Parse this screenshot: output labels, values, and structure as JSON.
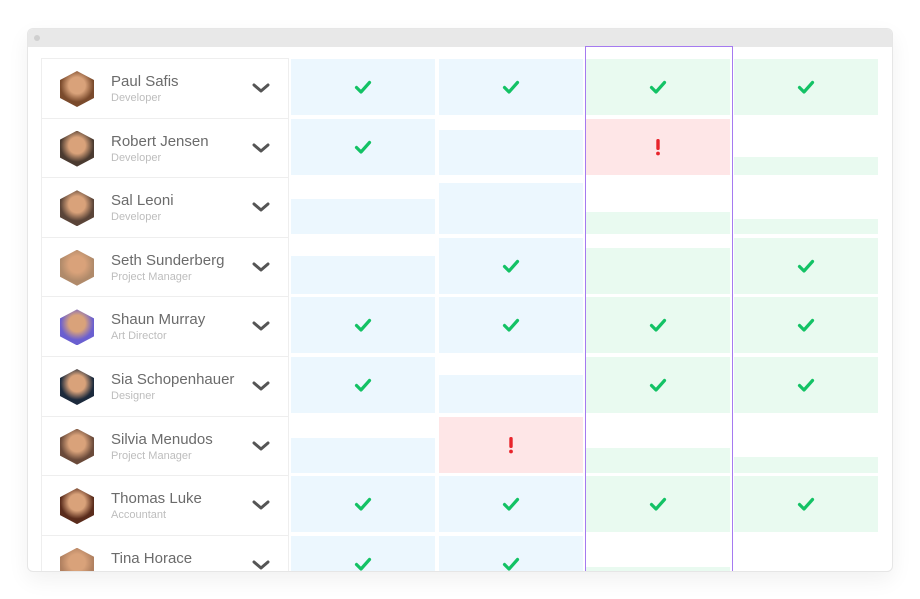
{
  "colors": {
    "check": "#13c265",
    "alert": "#e8242b",
    "blue_fill": "#ecf7fe",
    "green_fill": "#e9faf0",
    "red_fill": "#fee6e7",
    "highlight_border": "#a57af0"
  },
  "columns": [
    {
      "tone": "blue"
    },
    {
      "tone": "blue"
    },
    {
      "tone": "green",
      "highlighted": true
    },
    {
      "tone": "green"
    }
  ],
  "people": [
    {
      "name": "Paul Safis",
      "role": "Developer",
      "avatar_color": "#7a4a2c",
      "cells": [
        {
          "fill": 1.0,
          "status": "check"
        },
        {
          "fill": 1.0,
          "status": "check"
        },
        {
          "fill": 1.0,
          "status": "check"
        },
        {
          "fill": 1.0,
          "status": "check"
        }
      ]
    },
    {
      "name": "Robert Jensen",
      "role": "Developer",
      "avatar_color": "#4a3a30",
      "cells": [
        {
          "fill": 1.0,
          "status": "check"
        },
        {
          "fill": 0.8,
          "status": "none"
        },
        {
          "fill": 1.0,
          "status": "alert"
        },
        {
          "fill": 0.32,
          "status": "none"
        }
      ]
    },
    {
      "name": "Sal Leoni",
      "role": "Developer",
      "avatar_color": "#5a4438",
      "cells": [
        {
          "fill": 0.63,
          "status": "none"
        },
        {
          "fill": 0.92,
          "status": "none"
        },
        {
          "fill": 0.4,
          "status": "none"
        },
        {
          "fill": 0.27,
          "status": "none"
        }
      ]
    },
    {
      "name": "Seth Sunderberg",
      "role": "Project Manager",
      "avatar_color": "#b08a6a",
      "cells": [
        {
          "fill": 0.67,
          "status": "none"
        },
        {
          "fill": 1.0,
          "status": "check"
        },
        {
          "fill": 0.82,
          "status": "none"
        },
        {
          "fill": 1.0,
          "status": "check"
        }
      ]
    },
    {
      "name": "Shaun Murray",
      "role": "Art Director",
      "avatar_color": "#6a5fd0",
      "cells": [
        {
          "fill": 1.0,
          "status": "check"
        },
        {
          "fill": 1.0,
          "status": "check"
        },
        {
          "fill": 1.0,
          "status": "check"
        },
        {
          "fill": 1.0,
          "status": "check"
        }
      ]
    },
    {
      "name": "Sia Schopenhauer",
      "role": "Designer",
      "avatar_color": "#1c2a3c",
      "cells": [
        {
          "fill": 1.0,
          "status": "check"
        },
        {
          "fill": 0.68,
          "status": "none"
        },
        {
          "fill": 1.0,
          "status": "check"
        },
        {
          "fill": 1.0,
          "status": "check"
        }
      ]
    },
    {
      "name": "Silvia Menudos",
      "role": "Project Manager",
      "avatar_color": "#6a4a3a",
      "cells": [
        {
          "fill": 0.62,
          "status": "none"
        },
        {
          "fill": 1.0,
          "status": "alert"
        },
        {
          "fill": 0.44,
          "status": "none"
        },
        {
          "fill": 0.27,
          "status": "none"
        }
      ]
    },
    {
      "name": "Thomas Luke",
      "role": "Accountant",
      "avatar_color": "#5a2c1c",
      "cells": [
        {
          "fill": 1.0,
          "status": "check"
        },
        {
          "fill": 1.0,
          "status": "check"
        },
        {
          "fill": 1.0,
          "status": "check"
        },
        {
          "fill": 1.0,
          "status": "check"
        }
      ]
    },
    {
      "name": "Tina Horace",
      "role": "",
      "avatar_color": "#b08060",
      "cells": [
        {
          "fill": 1.0,
          "status": "check"
        },
        {
          "fill": 1.0,
          "status": "check"
        },
        {
          "fill": 0.45,
          "status": "none"
        },
        {
          "fill": 0.3,
          "status": "none"
        }
      ]
    }
  ]
}
